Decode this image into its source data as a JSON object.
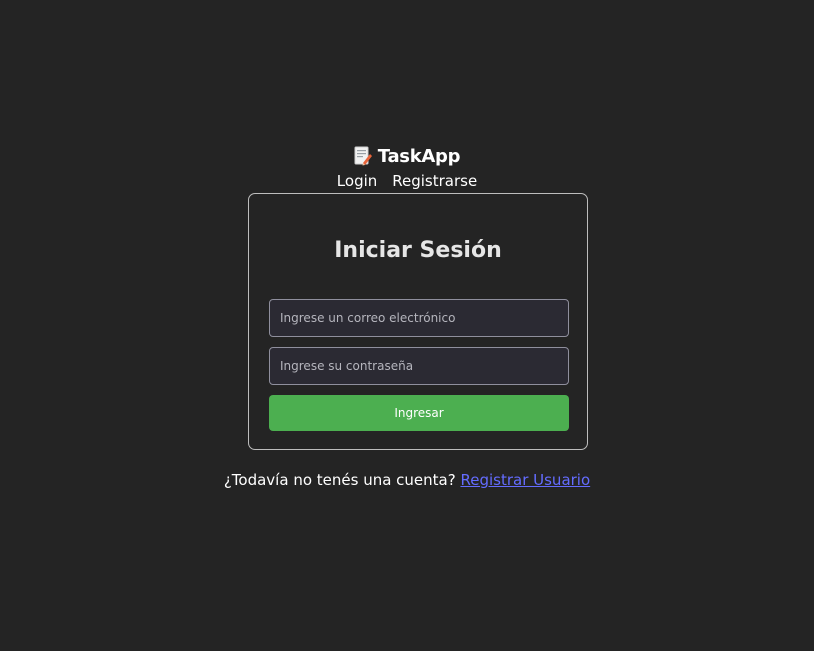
{
  "header": {
    "icon": "memo-icon",
    "title": "TaskApp",
    "nav": {
      "login": "Login",
      "register": "Registrarse"
    }
  },
  "login_card": {
    "title": "Iniciar Sesión",
    "email_placeholder": "Ingrese un correo electrónico",
    "email_value": "",
    "password_placeholder": "Ingrese su contraseña",
    "password_value": "",
    "submit_label": "Ingresar"
  },
  "footer": {
    "prompt": "¿Todavía no tenés una cuenta?",
    "link": "Registrar Usuario"
  },
  "colors": {
    "background": "#242424",
    "accent": "#4caf50",
    "link": "#646cff"
  }
}
